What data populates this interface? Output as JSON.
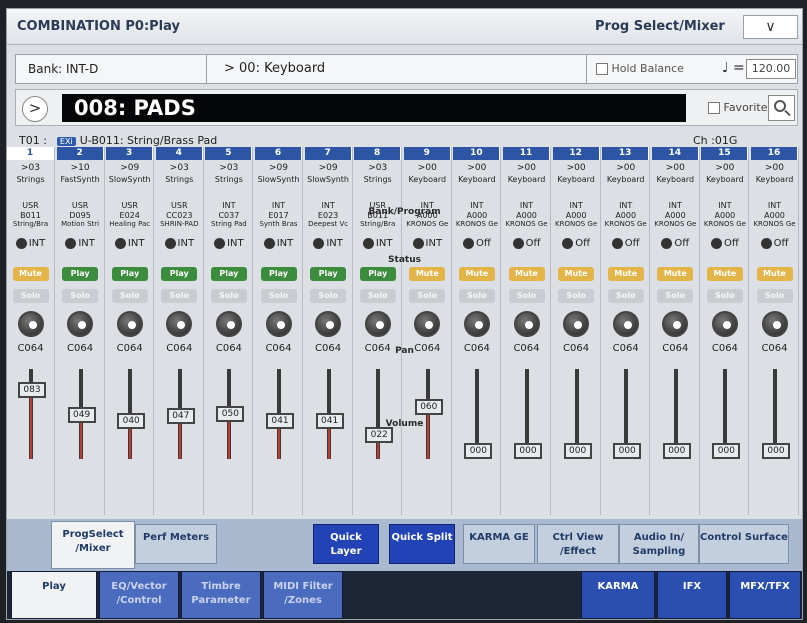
{
  "header": {
    "title": "COMBINATION P0:Play",
    "menu": "Prog Select/Mixer",
    "dropdown": "∨"
  },
  "bank": {
    "label": "Bank: INT-D",
    "program": "> 00: Keyboard",
    "hold_balance": "Hold Balance",
    "tempo_icon": "♩ =",
    "tempo": "120.00"
  },
  "combi": {
    "arrow": ">",
    "name": "008: PADS",
    "favorite": "Favorite"
  },
  "timbre_info": {
    "timbre": "T01 :",
    "exi": "EXi",
    "program": "U-B011: String/Brass Pad",
    "channel": "Ch :01G"
  },
  "section_labels": {
    "bank_program": "Bank/Program",
    "status": "Status",
    "pan": "Pan",
    "volume": "Volume"
  },
  "timbres": [
    {
      "num": "1",
      "prog_num": ">03",
      "category": "Strings",
      "bank": "USR",
      "bank_prog": "B011",
      "pname": "String/Bra",
      "status": "INT",
      "play": "Mute",
      "solo": "Solo",
      "pan": "C064",
      "volume": "083",
      "vol_level": 0.83
    },
    {
      "num": "2",
      "prog_num": ">10",
      "category": "FastSynth",
      "bank": "USR",
      "bank_prog": "D095",
      "pname": "Motion Stri",
      "status": "INT",
      "play": "Play",
      "solo": "Solo",
      "pan": "C064",
      "volume": "049",
      "vol_level": 0.49
    },
    {
      "num": "3",
      "prog_num": ">09",
      "category": "SlowSynth",
      "bank": "USR",
      "bank_prog": "E024",
      "pname": "Healing Pac",
      "status": "INT",
      "play": "Play",
      "solo": "Solo",
      "pan": "C064",
      "volume": "040",
      "vol_level": 0.4
    },
    {
      "num": "4",
      "prog_num": ">03",
      "category": "Strings",
      "bank": "USR",
      "bank_prog": "CC023",
      "pname": "SHRIN-PAD",
      "status": "INT",
      "play": "Play",
      "solo": "Solo",
      "pan": "C064",
      "volume": "047",
      "vol_level": 0.47
    },
    {
      "num": "5",
      "prog_num": ">03",
      "category": "Strings",
      "bank": "INT",
      "bank_prog": "C037",
      "pname": "String Pad",
      "status": "INT",
      "play": "Play",
      "solo": "Solo",
      "pan": "C064",
      "volume": "050",
      "vol_level": 0.5
    },
    {
      "num": "6",
      "prog_num": ">09",
      "category": "SlowSynth",
      "bank": "INT",
      "bank_prog": "E017",
      "pname": "Synth Bras",
      "status": "INT",
      "play": "Play",
      "solo": "Solo",
      "pan": "C064",
      "volume": "041",
      "vol_level": 0.41
    },
    {
      "num": "7",
      "prog_num": ">09",
      "category": "SlowSynth",
      "bank": "INT",
      "bank_prog": "E023",
      "pname": "Deepest Vc",
      "status": "INT",
      "play": "Play",
      "solo": "Solo",
      "pan": "C064",
      "volume": "041",
      "vol_level": 0.41
    },
    {
      "num": "8",
      "prog_num": ">03",
      "category": "Strings",
      "bank": "USR",
      "bank_prog": "B011",
      "pname": "String/Bra",
      "status": "INT",
      "play": "Play",
      "solo": "Solo",
      "pan": "C064",
      "volume": "022",
      "vol_level": 0.22
    },
    {
      "num": "9",
      "prog_num": ">00",
      "category": "Keyboard",
      "bank": "INT",
      "bank_prog": "A000",
      "pname": "KRONOS Ge",
      "status": "INT",
      "play": "Mute",
      "solo": "Solo",
      "pan": "C064",
      "volume": "060",
      "vol_level": 0.6
    },
    {
      "num": "10",
      "prog_num": ">00",
      "category": "Keyboard",
      "bank": "INT",
      "bank_prog": "A000",
      "pname": "KRONOS Ge",
      "status": "Off",
      "play": "Mute",
      "solo": "Solo",
      "pan": "C064",
      "volume": "000",
      "vol_level": 0.0
    },
    {
      "num": "11",
      "prog_num": ">00",
      "category": "Keyboard",
      "bank": "INT",
      "bank_prog": "A000",
      "pname": "KRONOS Ge",
      "status": "Off",
      "play": "Mute",
      "solo": "Solo",
      "pan": "C064",
      "volume": "000",
      "vol_level": 0.0
    },
    {
      "num": "12",
      "prog_num": ">00",
      "category": "Keyboard",
      "bank": "INT",
      "bank_prog": "A000",
      "pname": "KRONOS Ge",
      "status": "Off",
      "play": "Mute",
      "solo": "Solo",
      "pan": "C064",
      "volume": "000",
      "vol_level": 0.0
    },
    {
      "num": "13",
      "prog_num": ">00",
      "category": "Keyboard",
      "bank": "INT",
      "bank_prog": "A000",
      "pname": "KRONOS Ge",
      "status": "Off",
      "play": "Mute",
      "solo": "Solo",
      "pan": "C064",
      "volume": "000",
      "vol_level": 0.0
    },
    {
      "num": "14",
      "prog_num": ">00",
      "category": "Keyboard",
      "bank": "INT",
      "bank_prog": "A000",
      "pname": "KRONOS Ge",
      "status": "Off",
      "play": "Mute",
      "solo": "Solo",
      "pan": "C064",
      "volume": "000",
      "vol_level": 0.0
    },
    {
      "num": "15",
      "prog_num": ">00",
      "category": "Keyboard",
      "bank": "INT",
      "bank_prog": "A000",
      "pname": "KRONOS Ge",
      "status": "Off",
      "play": "Mute",
      "solo": "Solo",
      "pan": "C064",
      "volume": "000",
      "vol_level": 0.0
    },
    {
      "num": "16",
      "prog_num": ">00",
      "category": "Keyboard",
      "bank": "INT",
      "bank_prog": "A000",
      "pname": "KRONOS Ge",
      "status": "Off",
      "play": "Mute",
      "solo": "Solo",
      "pan": "C064",
      "volume": "000",
      "vol_level": 0.0
    }
  ],
  "page_tabs": [
    "ProgSelect /Mixer",
    "Perf Meters",
    "Quick Layer",
    "Quick Split",
    "KARMA GE",
    "Ctrl View /Effect",
    "Audio In/ Sampling",
    "Control Surface"
  ],
  "mode_tabs": [
    "Play",
    "EQ/Vector /Control",
    "Timbre Parameter",
    "MIDI Filter /Zones",
    "KARMA",
    "IFX",
    "MFX/TFX"
  ],
  "colors": {
    "accent": "#2c55a3",
    "play": "#3b8c3c",
    "mute": "#e3b548",
    "fader_rail": "#c23a2e"
  }
}
